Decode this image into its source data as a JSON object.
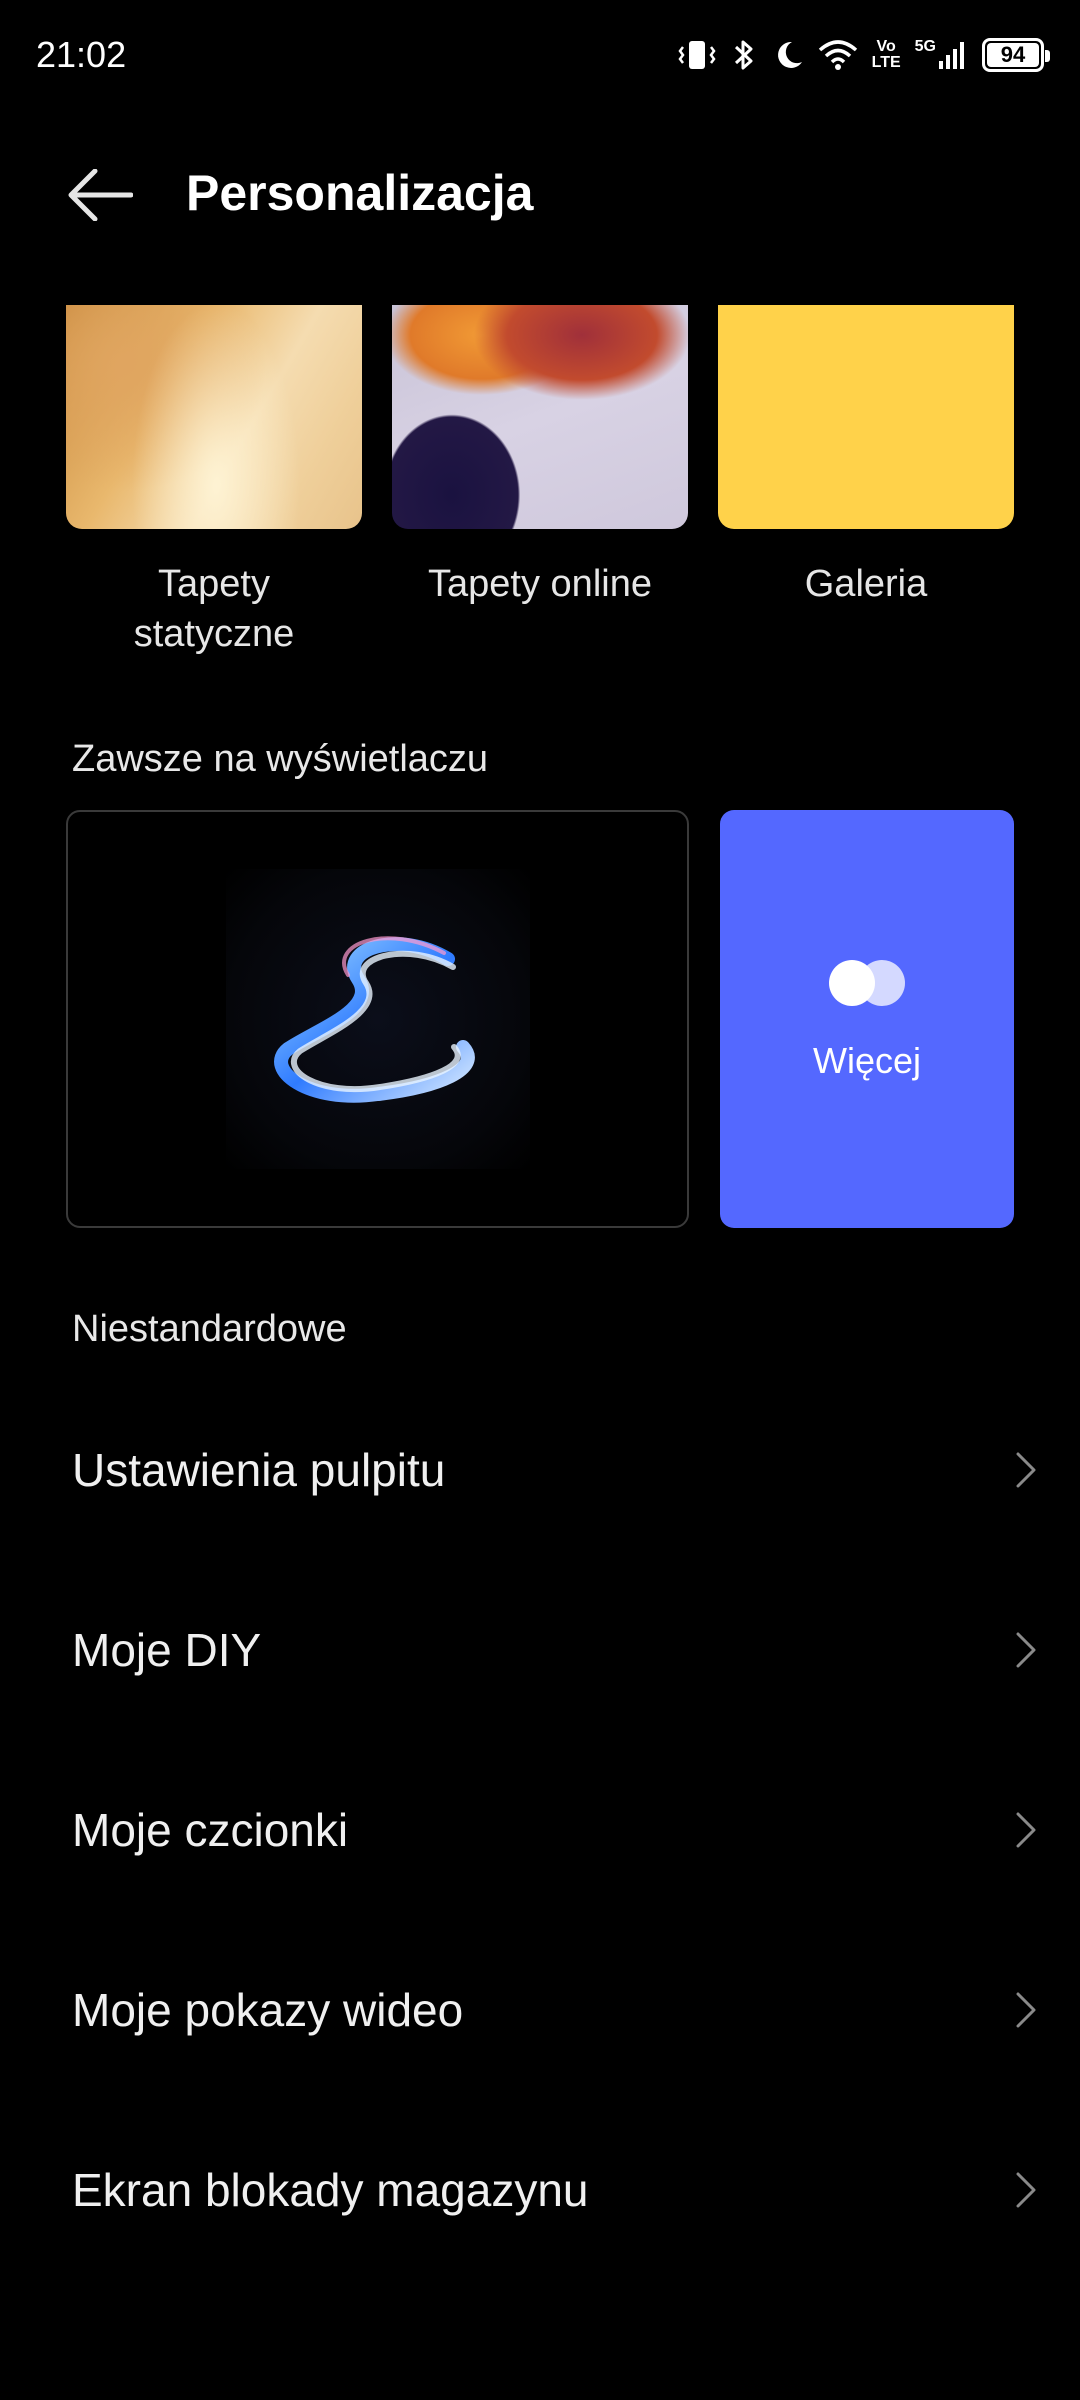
{
  "status_bar": {
    "time": "21:02",
    "net_volte_top": "Vo",
    "net_volte_bottom": "LTE",
    "net_5g": "5G",
    "battery_level": "94",
    "icons": [
      "vibrate-icon",
      "bluetooth-icon",
      "moon-icon",
      "wifi-icon",
      "volte-icon",
      "signal-icon",
      "battery-icon"
    ]
  },
  "header": {
    "title": "Personalizacja"
  },
  "wallpapers": {
    "items": [
      {
        "label": "Tapety statyczne"
      },
      {
        "label": "Tapety online"
      },
      {
        "label": "Galeria"
      }
    ],
    "gallery_color": "#ffd24a"
  },
  "aod": {
    "section_title": "Zawsze na wyświetlaczu",
    "more_label": "Więcej",
    "more_color": "#5468ff"
  },
  "custom": {
    "section_title": "Niestandardowe",
    "items": [
      {
        "label": "Ustawienia pulpitu"
      },
      {
        "label": "Moje DIY"
      },
      {
        "label": "Moje czcionki"
      },
      {
        "label": "Moje pokazy wideo"
      },
      {
        "label": "Ekran blokady magazynu"
      }
    ]
  }
}
